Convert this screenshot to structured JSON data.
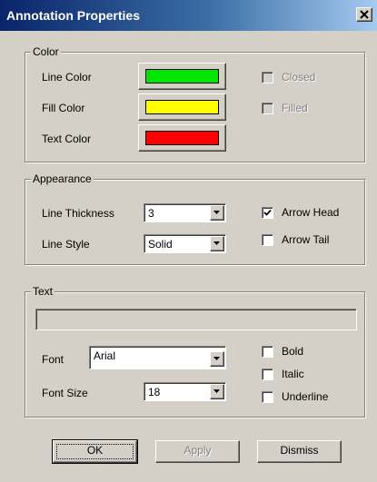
{
  "window": {
    "title": "Annotation Properties"
  },
  "color_group": {
    "legend": "Color",
    "line_color_label": "Line Color",
    "fill_color_label": "Fill Color",
    "text_color_label": "Text Color",
    "line_color": "#00e600",
    "fill_color": "#ffff00",
    "text_color": "#ff0000",
    "closed": {
      "label": "Closed",
      "checked": false,
      "enabled": false
    },
    "filled": {
      "label": "Filled",
      "checked": false,
      "enabled": false
    }
  },
  "appearance_group": {
    "legend": "Appearance",
    "line_thickness_label": "Line Thickness",
    "line_thickness_value": "3",
    "line_style_label": "Line Style",
    "line_style_value": "Solid",
    "arrow_head": {
      "label": "Arrow Head",
      "checked": true
    },
    "arrow_tail": {
      "label": "Arrow Tail",
      "checked": false
    }
  },
  "text_group": {
    "legend": "Text",
    "text_value": "",
    "font_label": "Font",
    "font_value": "Arial",
    "font_size_label": "Font Size",
    "font_size_value": "18",
    "bold": {
      "label": "Bold",
      "checked": false
    },
    "italic": {
      "label": "Italic",
      "checked": false
    },
    "underline": {
      "label": "Underline",
      "checked": false
    }
  },
  "buttons": {
    "ok": "OK",
    "apply": "Apply",
    "dismiss": "Dismiss"
  },
  "icons": {
    "close": "close-icon",
    "dropdown": "chevron-down-icon",
    "check": "checkmark-icon"
  }
}
